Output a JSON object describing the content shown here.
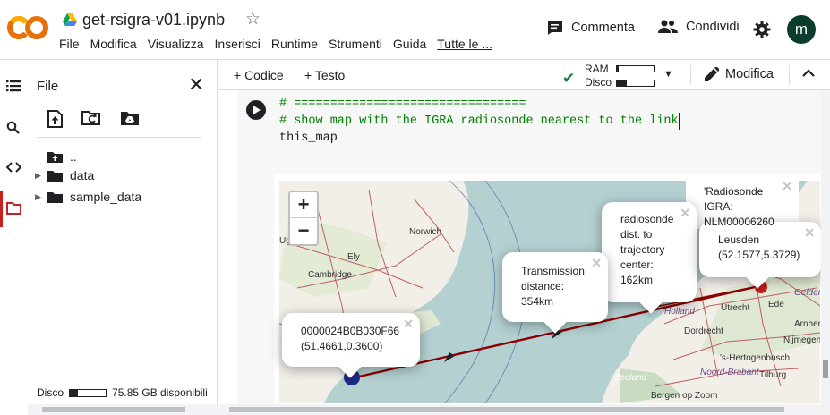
{
  "app": {
    "logo_text": "CO"
  },
  "notebook": {
    "title": "get-rsigra-v01.ipynb"
  },
  "menu": [
    "File",
    "Modifica",
    "Visualizza",
    "Inserisci",
    "Runtime",
    "Strumenti",
    "Guida",
    "Tutte le ..."
  ],
  "header": {
    "comment_label": "Commenta",
    "share_label": "Condividi",
    "avatar_letter": "m"
  },
  "files_panel": {
    "title": "File",
    "tree": [
      {
        "label": "..",
        "kind": "parent"
      },
      {
        "label": "data",
        "kind": "folder"
      },
      {
        "label": "sample_data",
        "kind": "folder"
      }
    ],
    "disk": {
      "label": "Disco",
      "free_text": "75.85 GB disponibili",
      "used_fraction": 0.22
    }
  },
  "toolbar": {
    "add_code": "+ Codice",
    "add_text": "+ Testo",
    "ram_label": "RAM",
    "disk_label": "Disco",
    "ram_used_fraction": 0.04,
    "disk_used_fraction": 0.28,
    "edit_label": "Modifica"
  },
  "cell": {
    "lines": [
      "# ================================",
      "# show map with the IGRA radiosonde nearest to the link",
      "this_map"
    ]
  },
  "map": {
    "zoom_in": "+",
    "zoom_out": "−",
    "place_labels": [
      "Norwich",
      "Cambridge",
      "Ely",
      "Utrecht",
      "Ede",
      "Gelder",
      "Holland",
      "Dordrecht",
      "Arnhem",
      "Nijmegen",
      "'s-Hertogenbosch",
      "Noord-Brabant",
      "Zeeland",
      "Tilburg",
      "Bergen op Zoom",
      "Ugh"
    ],
    "popups": {
      "radiosonde_igra": [
        "'Radiosonde",
        "IGRA:",
        "NLM00006260"
      ],
      "trajectory": [
        "radiosonde",
        "dist. to",
        "trajectory",
        "center:",
        "162km"
      ],
      "leusden": [
        "Leusden",
        "(52.1577,5.3729)"
      ],
      "transmission": [
        "Transmission",
        "distance:",
        "354km"
      ],
      "origin": [
        "0000024B0B030F66",
        "(51.4661,0.3600)"
      ]
    },
    "colors": {
      "sea": "#b4d0d1",
      "land": "#f2efe9",
      "route": "#8b0000",
      "marker_red": "#c81e1e",
      "marker_blue": "#1e2b8c"
    }
  }
}
